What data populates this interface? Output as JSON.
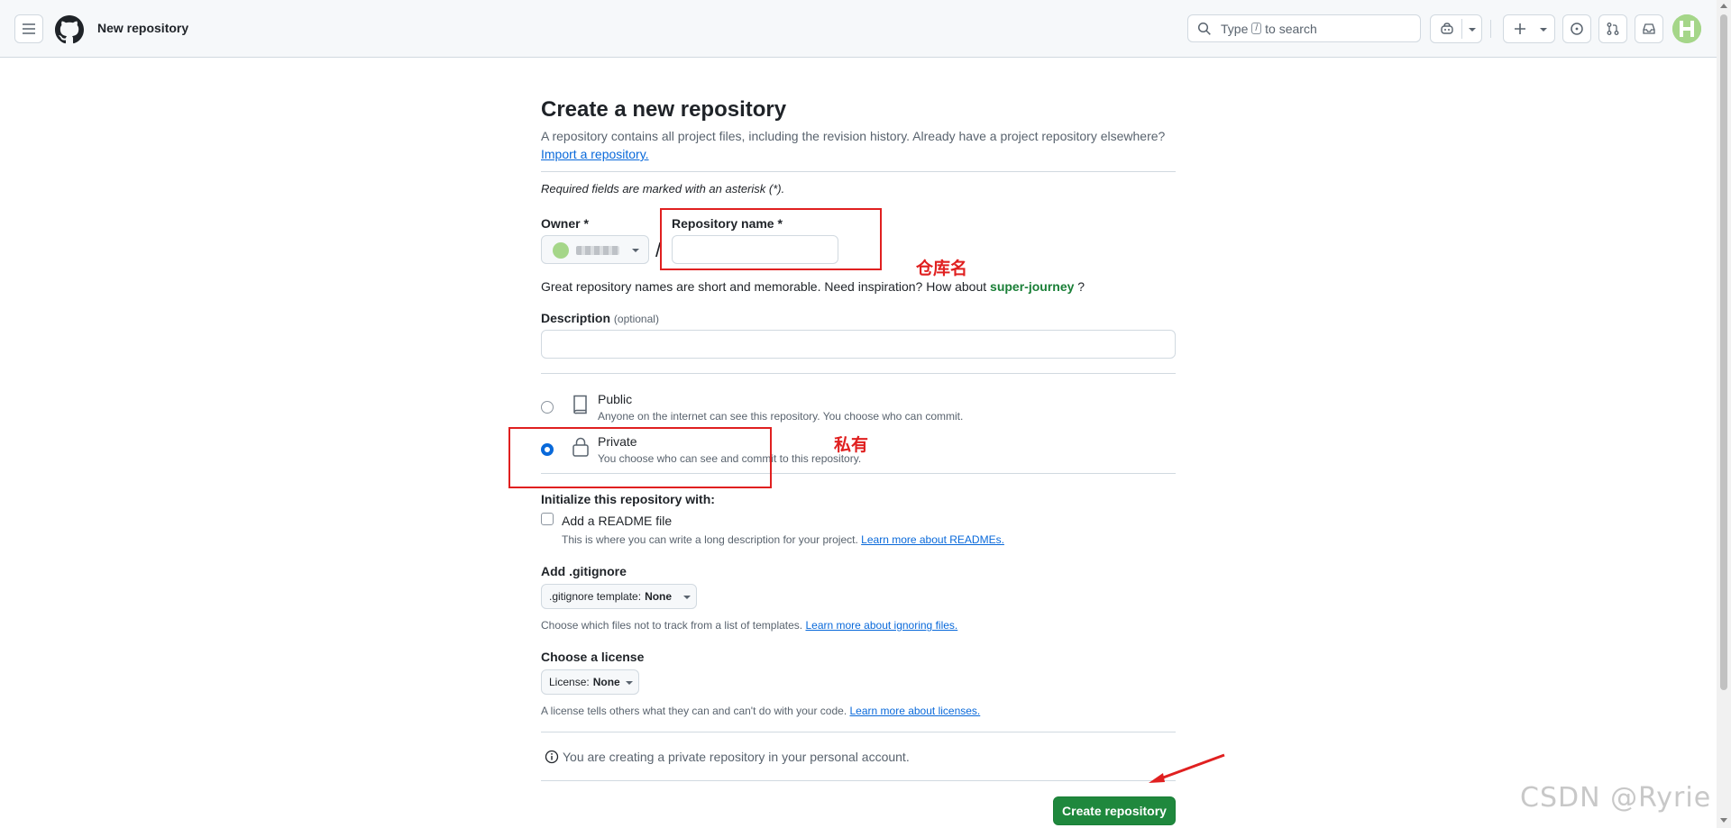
{
  "header": {
    "page_title": "New repository",
    "search_prefix": "Type",
    "search_key": "/",
    "search_suffix": "to search"
  },
  "form": {
    "title": "Create a new repository",
    "lead": "A repository contains all project files, including the revision history. Already have a project repository elsewhere?",
    "import_link": "Import a repository.",
    "required_note": "Required fields are marked with an asterisk (*).",
    "owner_label": "Owner *",
    "repo_name_label": "Repository name *",
    "repo_name_value": "",
    "slash": "/",
    "hint_prefix": "Great repository names are short and memorable. Need inspiration? How about",
    "hint_suggestion": "super-journey",
    "hint_suffix": "?",
    "description_label": "Description",
    "description_optional": "(optional)",
    "description_value": "",
    "visibility": [
      {
        "title": "Public",
        "desc": "Anyone on the internet can see this repository. You choose who can commit.",
        "selected": false,
        "icon": "repo-icon"
      },
      {
        "title": "Private",
        "desc": "You choose who can see and commit to this repository.",
        "selected": true,
        "icon": "lock-icon"
      }
    ],
    "init_heading": "Initialize this repository with:",
    "readme_label": "Add a README file",
    "readme_checked": false,
    "readme_desc": "This is where you can write a long description for your project.",
    "readme_link": "Learn more about READMEs.",
    "gitignore_heading": "Add .gitignore",
    "gitignore_select_label": ".gitignore template:",
    "gitignore_select_value": "None",
    "gitignore_desc": "Choose which files not to track from a list of templates.",
    "gitignore_link": "Learn more about ignoring files.",
    "license_heading": "Choose a license",
    "license_select_label": "License:",
    "license_select_value": "None",
    "license_desc": "A license tells others what they can and can't do with your code.",
    "license_link": "Learn more about licenses.",
    "info_text": "You are creating a private repository in your personal account.",
    "create_button": "Create repository"
  },
  "annotations": {
    "repo_name_note": "仓库名",
    "private_note": "私有",
    "watermark": "CSDN @Ryrie"
  },
  "colors": {
    "accent_blue": "#0969da",
    "primary_green": "#1f883d",
    "annotation_red": "#e02020"
  }
}
